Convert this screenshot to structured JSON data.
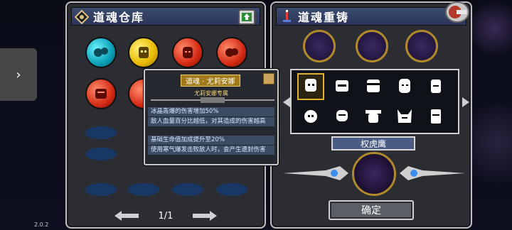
{
  "version": "2.0.2",
  "left_panel": {
    "title": "道魂仓库",
    "pager": {
      "page_text": "1/1"
    }
  },
  "right_panel": {
    "title": "道魂重铸",
    "selected_name": "权虎鹰",
    "confirm_label": "确定"
  },
  "tooltip": {
    "name": "道魂 · 尤莉安娜",
    "subtitle": "尤莉安娜专属",
    "effects": [
      "冰晶轰爆的伤害增加50%",
      "敌人血量百分比越低，对其造成的伤害越高",
      "基础生命值加成提升至20%",
      "使用寒气爆发击败敌人时，会产生遗封伤害"
    ]
  },
  "icons": {
    "title_left": "soul-gem-icon",
    "title_right": "soul-reforge-icon",
    "badge": "upgrade-badge-icon",
    "close": "close-icon",
    "prev": "arrow-left-icon",
    "next": "arrow-right-icon",
    "side_tab": "chevron-right-icon"
  },
  "colors": {
    "cyan_orb": "#0a9fb6",
    "yellow_orb": "#e6b800",
    "red_orb": "#d42a14",
    "gold_trim": "#b08a2a",
    "title_bar": "#2b3658"
  }
}
